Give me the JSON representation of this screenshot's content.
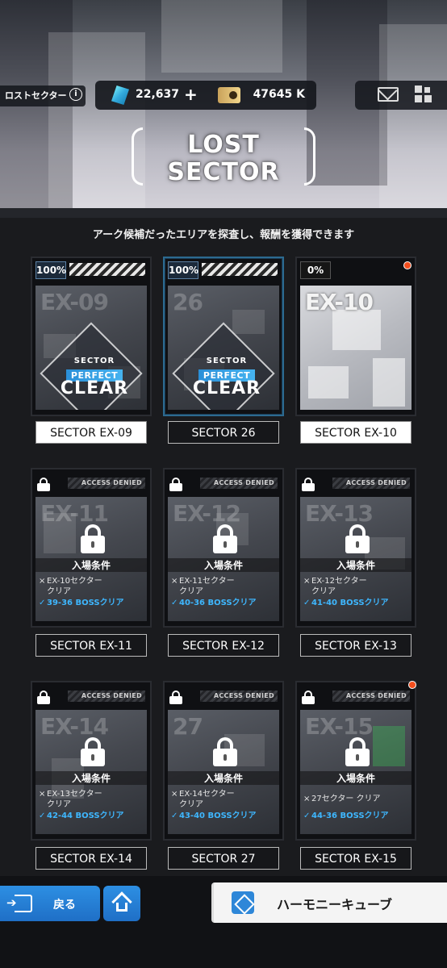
{
  "header": {
    "location_label": "ロストセクター",
    "info_icon": "info-icon",
    "crystal_amount": "22,637",
    "plus_label": "+",
    "credit_amount": "47645 K",
    "logo_line1": "LOST",
    "logo_line2": "SECTOR"
  },
  "subtitle": "アーク候補だったエリアを探査し、報酬を獲得できます",
  "sectors": [
    {
      "name": "SECTOR EX-09",
      "code": "EX-09",
      "percent": "100%",
      "status": "cleared"
    },
    {
      "name": "SECTOR 26",
      "code": "26",
      "percent": "100%",
      "status": "cleared"
    },
    {
      "name": "SECTOR EX-10",
      "code": "EX-10",
      "percent": "0%",
      "status": "open"
    },
    {
      "name": "SECTOR EX-11",
      "code": "EX-11",
      "status": "locked",
      "conditions": [
        {
          "mark": "×",
          "text": "EX-10セクター"
        },
        {
          "mark": "",
          "text": "クリア"
        },
        {
          "mark": "✓",
          "text": "39-36 BOSSクリア"
        }
      ]
    },
    {
      "name": "SECTOR EX-12",
      "code": "EX-12",
      "status": "locked",
      "conditions": [
        {
          "mark": "×",
          "text": "EX-11セクター"
        },
        {
          "mark": "",
          "text": "クリア"
        },
        {
          "mark": "✓",
          "text": "40-36 BOSSクリア"
        }
      ]
    },
    {
      "name": "SECTOR EX-13",
      "code": "EX-13",
      "status": "locked",
      "conditions": [
        {
          "mark": "×",
          "text": "EX-12セクター"
        },
        {
          "mark": "",
          "text": "クリア"
        },
        {
          "mark": "✓",
          "text": "41-40 BOSSクリア"
        }
      ]
    },
    {
      "name": "SECTOR EX-14",
      "code": "EX-14",
      "status": "locked",
      "conditions": [
        {
          "mark": "×",
          "text": "EX-13セクター"
        },
        {
          "mark": "",
          "text": "クリア"
        },
        {
          "mark": "✓",
          "text": "42-44 BOSSクリア"
        }
      ]
    },
    {
      "name": "SECTOR 27",
      "code": "27",
      "status": "locked",
      "conditions": [
        {
          "mark": "×",
          "text": "EX-14セクター"
        },
        {
          "mark": "",
          "text": "クリア"
        },
        {
          "mark": "✓",
          "text": "43-40 BOSSクリア"
        }
      ]
    },
    {
      "name": "SECTOR EX-15",
      "code": "EX-15",
      "status": "locked",
      "conditions": [
        {
          "mark": "×",
          "text": "27セクター クリア"
        },
        {
          "mark": "✓",
          "text": "44-36 BOSSクリア"
        }
      ]
    }
  ],
  "badge": {
    "sector": "SECTOR",
    "perfect": "PERFECT",
    "clear": "CLEAR"
  },
  "locked": {
    "access_denied": "ACCESS DENIED",
    "cond_title": "入場条件"
  },
  "footer": {
    "back_label": "戻る",
    "harmony_label": "ハーモニーキューブ"
  },
  "colors": {
    "accent": "#2d8fe3",
    "alert": "#f24e1e",
    "ok": "#3eb7ff"
  }
}
